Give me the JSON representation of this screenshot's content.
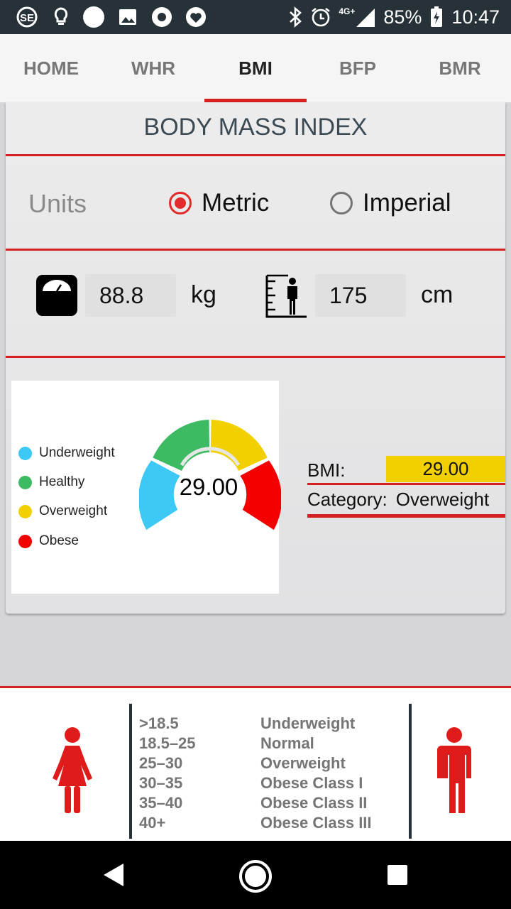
{
  "status_bar": {
    "network": "4G+",
    "battery": "85%",
    "time": "10:47"
  },
  "tabs": [
    {
      "label": "HOME"
    },
    {
      "label": "WHR"
    },
    {
      "label": "BMI",
      "active": true
    },
    {
      "label": "BFP"
    },
    {
      "label": "BMR"
    }
  ],
  "card": {
    "title": "BODY MASS INDEX",
    "units_label": "Units",
    "unit_options": [
      {
        "label": "Metric",
        "selected": true
      },
      {
        "label": "Imperial",
        "selected": false
      }
    ],
    "weight": {
      "value": "88.8",
      "unit": "kg"
    },
    "height": {
      "value": "175",
      "unit": "cm"
    }
  },
  "gauge": {
    "value_text": "29.00",
    "legend": [
      {
        "label": "Underweight",
        "color": "#3ec8f5"
      },
      {
        "label": "Healthy",
        "color": "#3dbb62"
      },
      {
        "label": "Overweight",
        "color": "#f2d000"
      },
      {
        "label": "Obese",
        "color": "#f40000"
      }
    ]
  },
  "result": {
    "bmi_label": "BMI:",
    "bmi_value": "29.00",
    "category_label": "Category:",
    "category_value": "Overweight"
  },
  "reference": {
    "ranges": [
      ">18.5",
      "18.5–25",
      "25–30",
      "30–35",
      "35–40",
      "40+"
    ],
    "categories": [
      "Underweight",
      "Normal",
      "Overweight",
      "Obese Class I",
      "Obese Class II",
      "Obese Class III"
    ]
  },
  "colors": {
    "accent": "#d42020",
    "figure": "#e01b1b"
  }
}
